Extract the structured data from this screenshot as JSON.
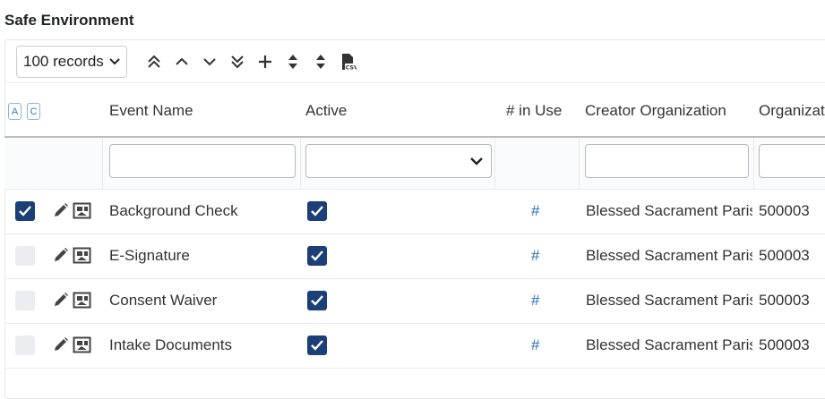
{
  "title": "Safe Environment",
  "toolbar": {
    "records_value": "100 records",
    "icons": [
      "double-chevron-up-icon",
      "chevron-up-icon",
      "chevron-down-icon",
      "double-chevron-down-icon",
      "plus-icon",
      "sort-expand-icon",
      "sort-collapse-icon",
      "csv-file-icon"
    ]
  },
  "header": {
    "toggle_a": "A",
    "toggle_c": "C",
    "columns": {
      "event_name": "Event Name",
      "active": "Active",
      "in_use": "# in Use",
      "creator_org": "Creator Organization",
      "organization": "Organizat"
    }
  },
  "filters": {
    "event_name": "",
    "active": "",
    "creator_org": "",
    "organization": ""
  },
  "rows": [
    {
      "selected": true,
      "event_name": "Background Check",
      "active": true,
      "in_use": "#",
      "creator_org": "Blessed Sacrament Paris",
      "org_id": "500003"
    },
    {
      "selected": false,
      "event_name": "E-Signature",
      "active": true,
      "in_use": "#",
      "creator_org": "Blessed Sacrament Paris",
      "org_id": "500003"
    },
    {
      "selected": false,
      "event_name": "Consent Waiver",
      "active": true,
      "in_use": "#",
      "creator_org": "Blessed Sacrament Paris",
      "org_id": "500003"
    },
    {
      "selected": false,
      "event_name": "Intake Documents",
      "active": true,
      "in_use": "#",
      "creator_org": "Blessed Sacrament Paris",
      "org_id": "500003"
    }
  ],
  "colors": {
    "checkbox_on": "#1b3f77",
    "link": "#2b6cb8",
    "toggle_border": "#8cb4dd"
  }
}
